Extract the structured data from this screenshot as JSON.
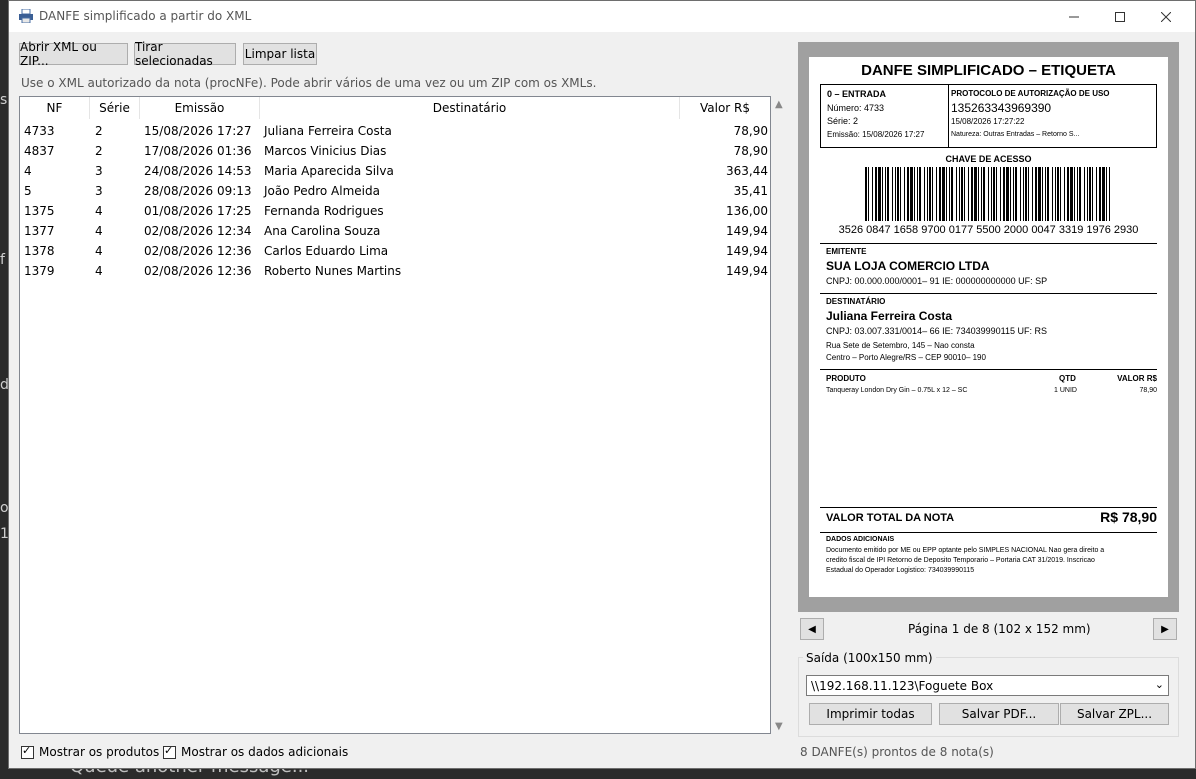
{
  "window": {
    "title": "DANFE simplificado a partir do XML"
  },
  "toolbar": {
    "open_label": "Abrir XML ou ZIP...",
    "remove_label": "Tirar selecionadas",
    "clear_label": "Limpar lista",
    "hint": "Use o XML autorizado da nota (procNFe). Pode abrir vários de uma vez ou um ZIP com os XMLs."
  },
  "table": {
    "headers": [
      "NF",
      "Série",
      "Emissão",
      "Destinatário",
      "Valor R$"
    ],
    "rows": [
      [
        "4733",
        "2",
        "15/08/2026 17:27",
        "Juliana Ferreira Costa",
        "78,90"
      ],
      [
        "4837",
        "2",
        "17/08/2026 01:36",
        "Marcos Vinicius Dias",
        "78,90"
      ],
      [
        "4",
        "3",
        "24/08/2026 14:53",
        "Maria Aparecida Silva",
        "363,44"
      ],
      [
        "5",
        "3",
        "28/08/2026 09:13",
        "João Pedro Almeida",
        "35,41"
      ],
      [
        "1375",
        "4",
        "01/08/2026 17:25",
        "Fernanda Rodrigues",
        "136,00"
      ],
      [
        "1377",
        "4",
        "02/08/2026 12:34",
        "Ana Carolina Souza",
        "149,94"
      ],
      [
        "1378",
        "4",
        "02/08/2026 12:36",
        "Carlos Eduardo Lima",
        "149,94"
      ],
      [
        "1379",
        "4",
        "02/08/2026 12:36",
        "Roberto Nunes Martins",
        "149,94"
      ]
    ]
  },
  "options": {
    "show_products": "Mostrar os produtos",
    "show_additional": "Mostrar os dados adicionais"
  },
  "label": {
    "title": "DANFE SIMPLIFICADO – ETIQUETA",
    "op_type": "0 – ENTRADA",
    "numero": "Número: 4733",
    "serie": "Série: 2",
    "emissao": "Emissão: 15/08/2026 17:27",
    "protocol_title": "PROTOCOLO DE AUTORIZAÇÃO DE USO",
    "protocol_number": "135263343969390",
    "protocol_datetime": "15/08/2026 17:27:22",
    "natureza": "Natureza: Outras Entradas – Retorno S...",
    "chave_title": "CHAVE DE ACESSO",
    "chave": "3526 0847 1658 9700 0177 5500 2000 0047 3319 1976 2930",
    "emitente_title": "EMITENTE",
    "emitente_name": "SUA LOJA COMERCIO LTDA",
    "emitente_doc": "CNPJ: 00.000.000/0001– 91   IE: 000000000000   UF: SP",
    "dest_title": "DESTINATÁRIO",
    "dest_name": "Juliana Ferreira Costa",
    "dest_doc": "CNPJ: 03.007.331/0014– 66   IE: 734039990115   UF: RS",
    "dest_addr1": "Rua Sete de Setembro, 145 – Nao consta",
    "dest_addr2": "Centro – Porto Alegre/RS – CEP 90010– 190",
    "prod_head": "PRODUTO",
    "qtd_head": "QTD",
    "valor_head": "VALOR R$",
    "prod_desc": "Tanqueray London Dry Gin – 0.75L x 12 – SC",
    "prod_qtd": "1 UNID",
    "prod_valor": "78,90",
    "total_label": "VALOR TOTAL DA NOTA",
    "total_value": "R$ 78,90",
    "dados_title": "DADOS ADICIONAIS",
    "dados_text1": "Documento emitido por ME ou EPP optante pelo SIMPLES NACIONAL Nao gera direito a",
    "dados_text2": "credito fiscal de IPI Retorno de Deposito Temporario – Portaria CAT 31/2019. Inscricao",
    "dados_text3": "Estadual do Operador Logistico: 734039990115"
  },
  "pager": {
    "text": "Página 1 de 8   (102 x 152 mm)"
  },
  "output": {
    "group_title": "Saída (100x150 mm)",
    "printer": "\\\\192.168.11.123\\Foguete Box",
    "print_all": "Imprimir todas",
    "save_pdf": "Salvar PDF...",
    "save_zpl": "Salvar ZPL..."
  },
  "status": "8 DANFE(s) prontos de 8 nota(s)",
  "background": {
    "bottom_text": "Queue another message..."
  }
}
